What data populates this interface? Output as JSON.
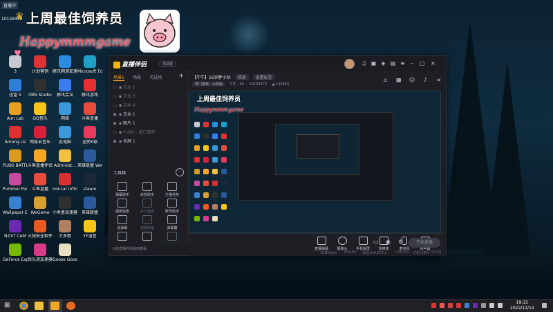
{
  "overlay": {
    "live_badge": "直播中",
    "room_id": "10159472",
    "title": "上周最佳饲养员",
    "subtitle": "Happymmmgame"
  },
  "desktop_icons": [
    {
      "label": "3",
      "color": "#c8c8d0"
    },
    {
      "label": "计划营销",
      "color": "#d33"
    },
    {
      "label": "腾讯网游加速器",
      "color": "#2a8de0"
    },
    {
      "label": "Microsoft Edge",
      "color": "#1fa0c8"
    },
    {
      "label": "迅雷 5",
      "color": "#2e7fd8"
    },
    {
      "label": "OBS Studio",
      "color": "#303030"
    },
    {
      "label": "腾讯会议",
      "color": "#3b7bf0"
    },
    {
      "label": "腾讯游戏",
      "color": "#e83030"
    },
    {
      "label": "Aim Lab",
      "color": "#e8a020"
    },
    {
      "label": "QQ音乐",
      "color": "#f5c518"
    },
    {
      "label": "网络",
      "color": "#3a9ad9"
    },
    {
      "label": "斗鱼直播",
      "color": "#e84c3d"
    },
    {
      "label": "Among Us",
      "color": "#e03030"
    },
    {
      "label": "网易云音乐",
      "color": "#d8203a"
    },
    {
      "label": "此电脑",
      "color": "#3a9ad9"
    },
    {
      "label": "全民K歌",
      "color": "#e83a5a"
    },
    {
      "label": "PUBG BATTLEGR...",
      "color": "#d89a20"
    },
    {
      "label": "斗鱼直播伴侣",
      "color": "#f5a623"
    },
    {
      "label": "Administ...",
      "color": "#f0c040"
    },
    {
      "label": "英雄联盟 WeGame版",
      "color": "#2a5a9a"
    },
    {
      "label": "Pummel Party",
      "color": "#c84aa0"
    },
    {
      "label": "斗鱼直播",
      "color": "#e84c3d"
    },
    {
      "label": "Ironcat Infinity...",
      "color": "#d83030"
    },
    {
      "label": "steam",
      "color": "#1b2838"
    },
    {
      "label": "Wallpaper Engine:...",
      "color": "#3a80d0"
    },
    {
      "label": "WeGame",
      "color": "#d8a030"
    },
    {
      "label": "小黑盒加速器",
      "color": "#303030"
    },
    {
      "label": "英雄联盟",
      "color": "#2a5a9a"
    },
    {
      "label": "NZXT CAM",
      "color": "#6a2ab0"
    },
    {
      "label": "火绒安全软件",
      "color": "#e85a20"
    },
    {
      "label": "大多数",
      "color": "#b08060"
    },
    {
      "label": "YY语音",
      "color": "#f5c518"
    },
    {
      "label": "GeForce Experience",
      "color": "#76b900"
    },
    {
      "label": "快乐游加速器",
      "color": "#d83a8a"
    },
    {
      "label": "Goose Goose Duck",
      "color": "#e8e0c0"
    }
  ],
  "app": {
    "logo": "直播伴侣",
    "version": "测试版",
    "sidebar_tabs": [
      "场景1",
      "场景",
      "可选场"
    ],
    "add": "+",
    "sources": [
      {
        "name": "文本 2",
        "on": false
      },
      {
        "name": "文本 3",
        "on": false
      },
      {
        "name": "文本 4",
        "on": false
      },
      {
        "name": "文本 1",
        "on": true
      },
      {
        "name": "图片 1",
        "on": true
      },
      {
        "name": "PUBG - 窗口捕获",
        "on": false
      },
      {
        "name": "全屏 1",
        "on": true
      }
    ],
    "tools_title": "工具箱",
    "tools": [
      {
        "label": "弹幕助手",
        "dim": false
      },
      {
        "label": "房管助手",
        "dim": false
      },
      {
        "label": "主播任务",
        "dim": false
      },
      {
        "label": "视频连麦",
        "dim": false
      },
      {
        "label": "多人连麦",
        "dim": true
      },
      {
        "label": "账号助手",
        "dim": false
      },
      {
        "label": "说弹幕",
        "dim": false
      },
      {
        "label": "虚拟形象",
        "dim": true
      },
      {
        "label": "弹幕魔",
        "dim": false
      },
      {
        "label": "",
        "dim": false
      },
      {
        "label": "",
        "dim": false
      },
      {
        "label": "",
        "dim": true
      }
    ],
    "sidebar_foot": "斗鱼直播伴侣使用教程",
    "room_line": "【牛牛】16岁胖小伙",
    "room_tag": "修改",
    "room_btn": "设置标签",
    "category": "热门游戏 - 大杂烩",
    "room_label": "牛牛 - 94",
    "room_number": "10159472",
    "followers": "134643",
    "bottom_buttons": [
      "直播弹幕",
      "摄像头",
      "手机投屏",
      "多媒体",
      "麦克风",
      "扬声器"
    ],
    "start_live": "开始直播",
    "stats": [
      "码率0kb/s",
      "FPS:60",
      "丢帧:0(0.00%)",
      "CPU:6%",
      "内存:18%",
      "00:00"
    ]
  },
  "taskbar": {
    "time": "19:15",
    "date": "2022/12/14"
  }
}
